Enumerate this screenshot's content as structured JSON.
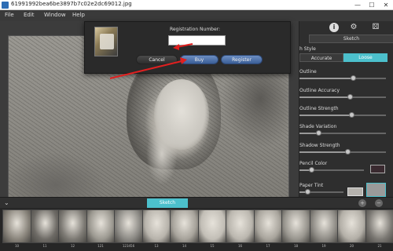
{
  "window": {
    "title": "61991992bea6be3897b7c02e2dc69012.jpg",
    "controls": [
      "—",
      "☐",
      "✕"
    ]
  },
  "menu": {
    "items": [
      "File",
      "Edit",
      "Window",
      "Help"
    ]
  },
  "dialog": {
    "registration_label": "Registration Number:",
    "registration_value": "",
    "cancel_label": "Cancel",
    "buy_label": "Buy",
    "register_label": "Register"
  },
  "panel": {
    "icons": [
      "info-icon",
      "gear-icon",
      "dice-icon"
    ],
    "header": "Sketch",
    "style_label": "h Style",
    "style_options": [
      "Accurate",
      "Loose"
    ],
    "style_selected": "Loose",
    "sliders": [
      {
        "label": "Outline",
        "value": 0.62
      },
      {
        "label": "Outline Accuracy",
        "value": 0.58
      },
      {
        "label": "Outline Strength",
        "value": 0.6
      },
      {
        "label": "Shade Variation",
        "value": 0.22
      },
      {
        "label": "Shadow Strength",
        "value": 0.55
      },
      {
        "label": "Pencil Color",
        "value": 0.18
      },
      {
        "label": "Paper Tint",
        "value": 0.18
      }
    ],
    "pencil_color": "#3a2a30",
    "accent_color": "#4cc0cc"
  },
  "strip": {
    "tab_label": "Sketch",
    "collapse_icon": "chevron-down-icon",
    "thumbnails": [
      "10",
      "11",
      "12",
      "121",
      "123456",
      "13",
      "14",
      "15",
      "16",
      "17",
      "18",
      "19",
      "20",
      "21"
    ]
  }
}
